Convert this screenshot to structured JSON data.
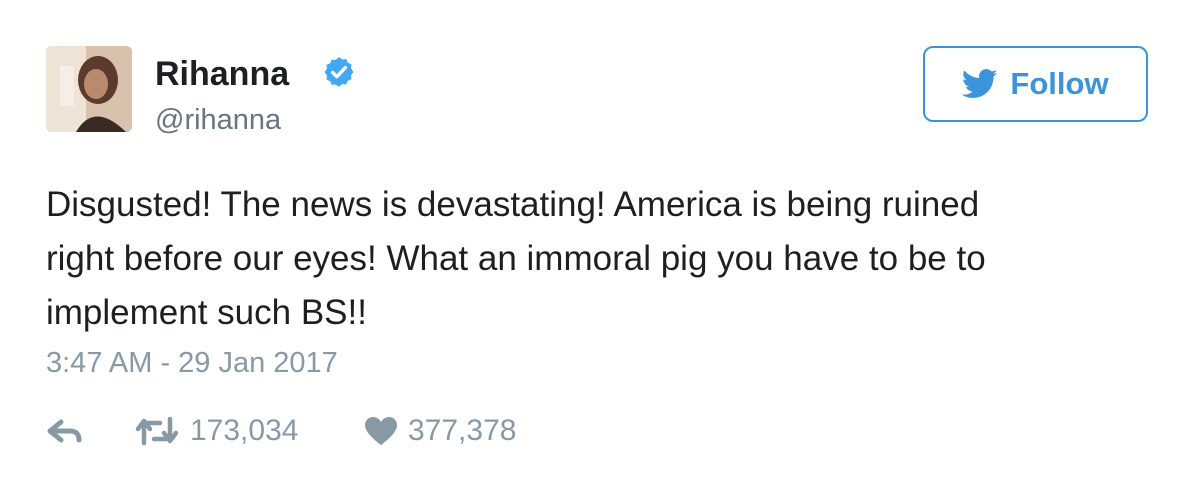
{
  "user": {
    "name": "Rihanna",
    "handle": "@rihanna",
    "verified": true
  },
  "follow_button": {
    "label": "Follow"
  },
  "tweet": {
    "text": "Disgusted! The news is devastating! America is being ruined\nright before our eyes! What an immoral pig you have to be to\nimplement such BS!!",
    "timestamp": "3:47 AM - 29 Jan 2017"
  },
  "actions": {
    "retweet_count": "173,034",
    "like_count": "377,378"
  },
  "icons": {
    "verified": "verified-badge-icon",
    "follow": "twitter-bird-icon",
    "reply": "reply-icon",
    "retweet": "retweet-icon",
    "like": "heart-icon"
  },
  "colors": {
    "accent": "#3b94d9",
    "verified": "#1da1f2",
    "text": "#1c2022",
    "muted": "#8899a6",
    "handle": "#66757f"
  }
}
